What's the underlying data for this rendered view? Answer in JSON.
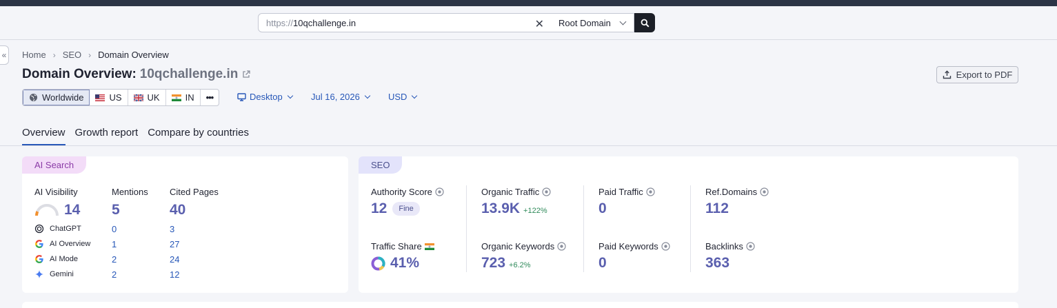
{
  "search": {
    "protocol": "https://",
    "host": "10qchallenge.in",
    "scope_select": "Root Domain"
  },
  "breadcrumb": [
    "Home",
    "SEO",
    "Domain Overview"
  ],
  "page": {
    "title": "Domain Overview:",
    "domain": "10qchallenge.in",
    "export_label": "Export to PDF"
  },
  "regions": [
    {
      "label": "Worldwide",
      "icon": "globe-icon",
      "active": true
    },
    {
      "label": "US",
      "icon": "us-flag-icon"
    },
    {
      "label": "UK",
      "icon": "uk-flag-icon"
    },
    {
      "label": "IN",
      "icon": "in-flag-icon"
    },
    {
      "label": "•••",
      "icon": "more-icon"
    }
  ],
  "filters": {
    "device": "Desktop",
    "date": "Jul 16, 2026",
    "currency": "USD"
  },
  "tabs": [
    "Overview",
    "Growth report",
    "Compare by countries"
  ],
  "ai_search": {
    "tag": "AI Search",
    "col_visibility": "AI Visibility",
    "col_mentions": "Mentions",
    "col_cited": "Cited Pages",
    "visibility": "14",
    "mentions": "5",
    "cited": "40",
    "rows": [
      {
        "name": "ChatGPT",
        "mentions": "0",
        "cited": "3"
      },
      {
        "name": "AI Overview",
        "mentions": "1",
        "cited": "27"
      },
      {
        "name": "AI Mode",
        "mentions": "2",
        "cited": "24"
      },
      {
        "name": "Gemini",
        "mentions": "2",
        "cited": "12"
      }
    ]
  },
  "seo": {
    "tag": "SEO",
    "authority_label": "Authority Score",
    "authority_value": "12",
    "authority_badge": "Fine",
    "organic_traffic_label": "Organic Traffic",
    "organic_traffic_value": "13.9K",
    "organic_traffic_delta": "+122%",
    "paid_traffic_label": "Paid Traffic",
    "paid_traffic_value": "0",
    "ref_domains_label": "Ref.Domains",
    "ref_domains_value": "112",
    "traffic_share_label": "Traffic Share",
    "traffic_share_value": "41%",
    "organic_keywords_label": "Organic Keywords",
    "organic_keywords_value": "723",
    "organic_keywords_delta": "+6.2%",
    "paid_keywords_label": "Paid Keywords",
    "paid_keywords_value": "0",
    "backlinks_label": "Backlinks",
    "backlinks_value": "363"
  },
  "colors": {
    "accent": "#2757b8",
    "metric": "#5a5fae",
    "ai_tag_bg": "#f3dcf8",
    "seo_tag_bg": "#e3e3fb"
  }
}
